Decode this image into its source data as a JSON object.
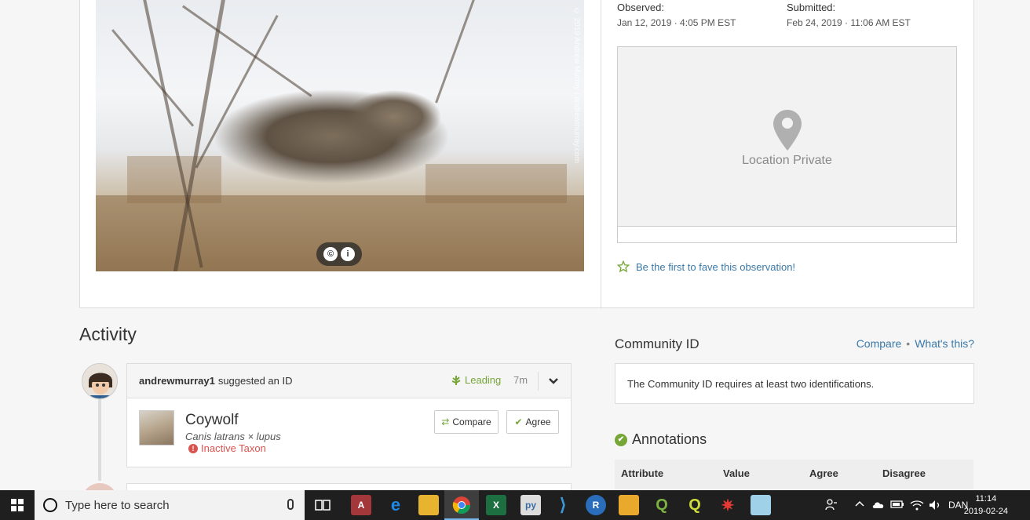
{
  "observation": {
    "observed_label": "Observed:",
    "observed_value": "Jan 12, 2019 · 4:05 PM EST",
    "submitted_label": "Submitted:",
    "submitted_value": "Feb 24, 2019 · 11:06 AM EST",
    "location_text": "Location Private",
    "fave_text": "Be the first to fave this observation!",
    "photo_credit": "© 2019 Andrew Murray | andrewmurray.com"
  },
  "activity": {
    "title": "Activity",
    "identification": {
      "user": "andrewmurray1",
      "action": "suggested an ID",
      "status": "Leading",
      "age": "7m",
      "common_name": "Coywolf",
      "scientific_name": "Canis latrans × lupus",
      "inactive_label": "Inactive Taxon",
      "compare_label": "Compare",
      "agree_label": "Agree"
    }
  },
  "community_id": {
    "title": "Community ID",
    "compare_link": "Compare",
    "whats_this_link": "What's this?",
    "message": "The Community ID requires at least two identifications."
  },
  "annotations": {
    "title": "Annotations",
    "columns": [
      "Attribute",
      "Value",
      "Agree",
      "Disagree"
    ]
  },
  "taskbar": {
    "search_placeholder": "Type here to search",
    "language": "DAN",
    "time": "11:14",
    "date": "2019-02-24",
    "apps": [
      "task-view",
      "access",
      "edge",
      "file-explorer",
      "chrome",
      "excel",
      "python",
      "vscode",
      "r",
      "database-tool",
      "qgis",
      "qgis-alt",
      "web-tool",
      "notepad"
    ]
  },
  "colors": {
    "accent_green": "#76a637",
    "link_blue": "#3a78a8",
    "error_red": "#d9534f"
  }
}
